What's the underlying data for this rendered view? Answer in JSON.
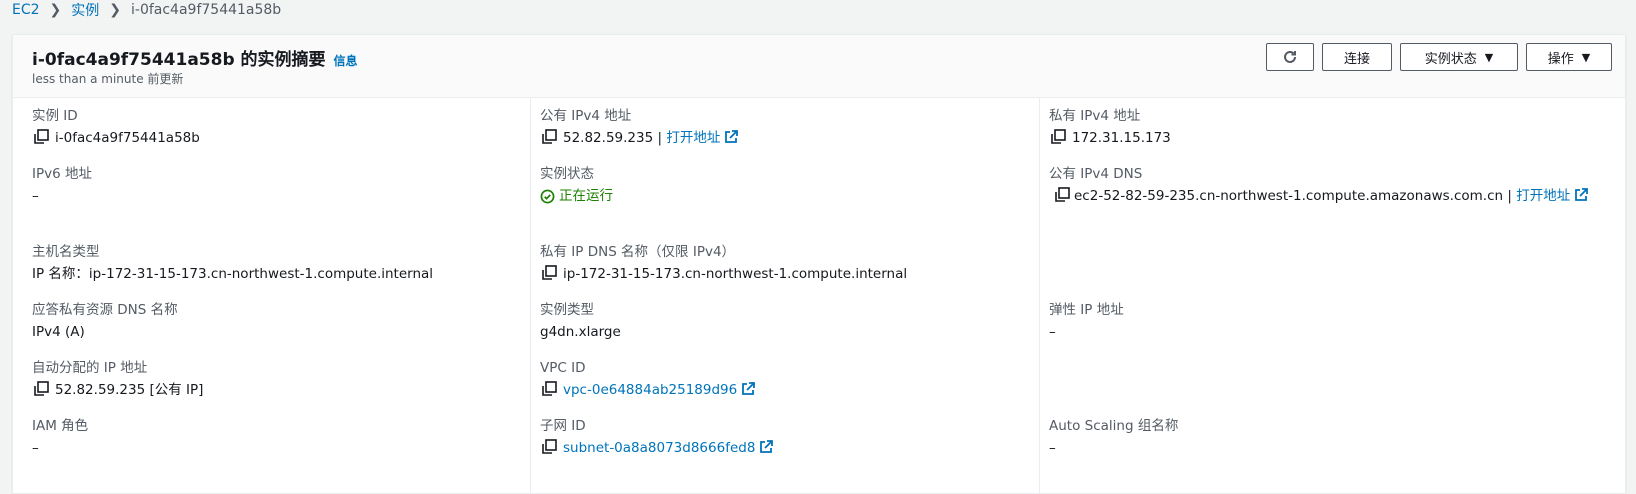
{
  "breadcrumb": {
    "items": [
      "EC2",
      "实例"
    ],
    "current": "i-0fac4a9f75441a58b"
  },
  "header": {
    "title": "i-0fac4a9f75441a58b 的实例摘要",
    "info_link": "信息",
    "subtitle": "less than a minute 前更新"
  },
  "actions": {
    "connect": "连接",
    "instance_state": "实例状态",
    "operations": "操作"
  },
  "fields": {
    "instance_id": {
      "label": "实例 ID",
      "value": "i-0fac4a9f75441a58b"
    },
    "ipv6": {
      "label": "IPv6 地址",
      "value": "–"
    },
    "hostname_type": {
      "label": "主机名类型",
      "value": "IP 名称：ip-172-31-15-173.cn-northwest-1.compute.internal"
    },
    "answer_dns": {
      "label": "应答私有资源 DNS 名称",
      "value": "IPv4 (A)"
    },
    "auto_ip": {
      "label": "自动分配的 IP 地址",
      "value": "52.82.59.235 [公有 IP]"
    },
    "iam_role": {
      "label": "IAM 角色",
      "value": "–"
    },
    "public_ipv4": {
      "label": "公有 IPv4 地址",
      "value": "52.82.59.235",
      "sep": "|",
      "link": "打开地址"
    },
    "instance_state": {
      "label": "实例状态",
      "value": "正在运行"
    },
    "private_ip_dns": {
      "label": "私有 IP DNS 名称（仅限 IPv4）",
      "value": "ip-172-31-15-173.cn-northwest-1.compute.internal"
    },
    "instance_type": {
      "label": "实例类型",
      "value": "g4dn.xlarge"
    },
    "vpc_id": {
      "label": "VPC ID",
      "value": "vpc-0e64884ab25189d96"
    },
    "subnet_id": {
      "label": "子网 ID",
      "value": "subnet-0a8a8073d8666fed8"
    },
    "private_ipv4": {
      "label": "私有 IPv4 地址",
      "value": "172.31.15.173"
    },
    "public_dns": {
      "label": "公有 IPv4 DNS",
      "value": "ec2-52-82-59-235.cn-northwest-1.compute.amazonaws.com.cn",
      "sep": "|",
      "link": "打开地址"
    },
    "elastic_ip": {
      "label": "弹性 IP 地址",
      "value": "–"
    },
    "asg_name": {
      "label": "Auto Scaling 组名称",
      "value": "–"
    }
  },
  "icons": {
    "copy": "copy-icon",
    "external": "external-link-icon",
    "refresh": "refresh-icon",
    "running": "check-circle-icon"
  },
  "colors": {
    "link": "#0073bb",
    "running": "#1d8102",
    "text": "#16191f",
    "muted": "#545b64"
  }
}
